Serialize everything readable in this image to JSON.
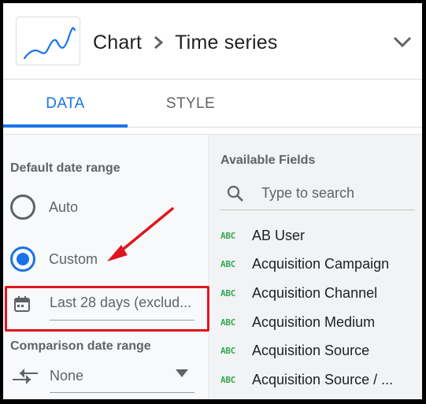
{
  "header": {
    "chart_label": "Chart",
    "chart_type": "Time series",
    "thumbnail_icon": "line-chart-icon",
    "collapse_icon": "chevron-down-icon"
  },
  "tabs": [
    {
      "label": "DATA",
      "active": true
    },
    {
      "label": "STYLE",
      "active": false
    }
  ],
  "date_range": {
    "section_label": "Default date range",
    "options": [
      {
        "label": "Auto",
        "selected": false
      },
      {
        "label": "Custom",
        "selected": true
      }
    ],
    "value": "Last 28 days (exclud...",
    "icon": "calendar-icon"
  },
  "comparison": {
    "section_label": "Comparison date range",
    "value": "None",
    "icon": "compare-arrows-icon"
  },
  "available_fields": {
    "title": "Available Fields",
    "search_placeholder": "Type to search",
    "type_badge": "ABC",
    "items": [
      "AB User",
      "Acquisition Campaign",
      "Acquisition Channel",
      "Acquisition Medium",
      "Acquisition Source",
      "Acquisition Source / ..."
    ]
  },
  "colors": {
    "accent": "#1a73e8",
    "annotation": "#e0161e",
    "dimension_badge": "#34a853"
  }
}
